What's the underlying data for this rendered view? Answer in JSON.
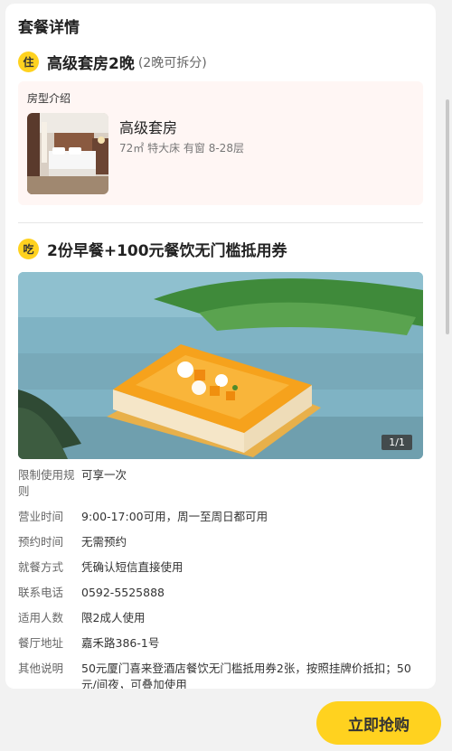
{
  "section": {
    "title": "套餐详情"
  },
  "room_item": {
    "badge": "住",
    "title": "高级套房2晚",
    "subtitle": "(2晚可拆分)"
  },
  "room_box": {
    "label": "房型介绍",
    "name": "高级套房",
    "meta": "72㎡  特大床  有窗  8-28层"
  },
  "food_item": {
    "badge": "吃",
    "title": "2份早餐+100元餐饮无门槛抵用券"
  },
  "food_photo": {
    "counter": "1/1"
  },
  "info": [
    {
      "key": "限制使用规则",
      "value": "可享一次"
    },
    {
      "key": "营业时间",
      "value": "9:00-17:00可用，周一至周日都可用"
    },
    {
      "key": "预约时间",
      "value": "无需预约"
    },
    {
      "key": "就餐方式",
      "value": "凭确认短信直接使用"
    },
    {
      "key": "联系电话",
      "value": "0592-5525888"
    },
    {
      "key": "适用人数",
      "value": "限2成人使用"
    },
    {
      "key": "餐厅地址",
      "value": "嘉禾路386-1号"
    },
    {
      "key": "其他说明",
      "value": "50元厦门喜来登酒店餐饮无门槛抵用券2张，按照挂牌价抵扣；50元/间夜，可叠加使用"
    }
  ],
  "buy_button": {
    "label": "立即抢购"
  },
  "colors": {
    "accent": "#ffd21f",
    "room_box_bg": "#fff6f4"
  }
}
